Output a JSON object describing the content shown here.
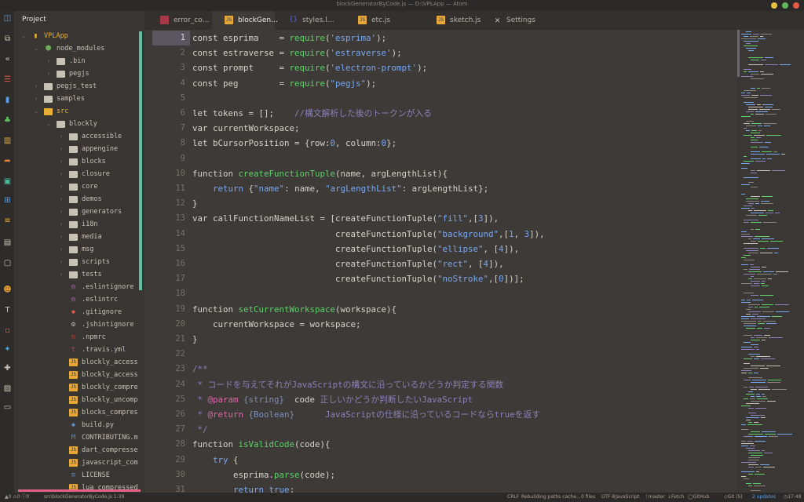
{
  "window": {
    "title": "blockGeneratorByCode.js — D:\\VPLApp — Atom"
  },
  "tree": {
    "header": "Project",
    "rows": [
      {
        "label": "VPLApp",
        "depth": 0,
        "arrow": "⌄",
        "icon": "repo-icon",
        "color": "#e8b030",
        "text_color": "#e8b030"
      },
      {
        "label": "node_modules",
        "depth": 1,
        "arrow": "⌄",
        "icon": "node-modules-icon",
        "color": "#6fae5a",
        "text_color": "#c8c1b6"
      },
      {
        "label": ".bin",
        "depth": 2,
        "arrow": "›",
        "icon": "folder-icon",
        "color": "#c8c1b6",
        "text_color": "#c8c1b6"
      },
      {
        "label": "pegjs",
        "depth": 2,
        "arrow": "›",
        "icon": "folder-icon",
        "color": "#c8c1b6",
        "text_color": "#c8c1b6"
      },
      {
        "label": "pegjs_test",
        "depth": 1,
        "arrow": "›",
        "icon": "folder-icon",
        "color": "#c8c1b6",
        "text_color": "#c8c1b6"
      },
      {
        "label": "samples",
        "depth": 1,
        "arrow": "›",
        "icon": "folder-icon",
        "color": "#c8c1b6",
        "text_color": "#c8c1b6"
      },
      {
        "label": "src",
        "depth": 1,
        "arrow": "⌄",
        "icon": "folder-open-icon",
        "color": "#e8b030",
        "text_color": "#e8b030"
      },
      {
        "label": "blockly",
        "depth": 2,
        "arrow": "⌄",
        "icon": "folder-open-icon",
        "color": "#c8c1b6",
        "text_color": "#c8c1b6"
      },
      {
        "label": "accessible",
        "depth": 3,
        "arrow": "›",
        "icon": "folder-icon",
        "color": "#c8c1b6",
        "text_color": "#c8c1b6"
      },
      {
        "label": "appengine",
        "depth": 3,
        "arrow": "›",
        "icon": "folder-icon",
        "color": "#c8c1b6",
        "text_color": "#c8c1b6"
      },
      {
        "label": "blocks",
        "depth": 3,
        "arrow": "›",
        "icon": "folder-icon",
        "color": "#c8c1b6",
        "text_color": "#c8c1b6"
      },
      {
        "label": "closure",
        "depth": 3,
        "arrow": "›",
        "icon": "folder-icon",
        "color": "#c8c1b6",
        "text_color": "#c8c1b6"
      },
      {
        "label": "core",
        "depth": 3,
        "arrow": "›",
        "icon": "folder-icon",
        "color": "#c8c1b6",
        "text_color": "#c8c1b6"
      },
      {
        "label": "demos",
        "depth": 3,
        "arrow": "›",
        "icon": "folder-icon",
        "color": "#c8c1b6",
        "text_color": "#c8c1b6"
      },
      {
        "label": "generators",
        "depth": 3,
        "arrow": "›",
        "icon": "folder-icon",
        "color": "#c8c1b6",
        "text_color": "#c8c1b6"
      },
      {
        "label": "i18n",
        "depth": 3,
        "arrow": "›",
        "icon": "folder-icon",
        "color": "#c8c1b6",
        "text_color": "#c8c1b6"
      },
      {
        "label": "media",
        "depth": 3,
        "arrow": "›",
        "icon": "folder-icon",
        "color": "#c8c1b6",
        "text_color": "#c8c1b6"
      },
      {
        "label": "msg",
        "depth": 3,
        "arrow": "›",
        "icon": "folder-icon",
        "color": "#c8c1b6",
        "text_color": "#c8c1b6"
      },
      {
        "label": "scripts",
        "depth": 3,
        "arrow": "›",
        "icon": "folder-icon",
        "color": "#c8c1b6",
        "text_color": "#c8c1b6"
      },
      {
        "label": "tests",
        "depth": 3,
        "arrow": "›",
        "icon": "folder-icon",
        "color": "#c8c1b6",
        "text_color": "#c8c1b6"
      },
      {
        "label": ".eslintignore",
        "depth": 3,
        "arrow": "",
        "icon": "eslint-icon",
        "color": "#c868c8",
        "text_color": "#c8c1b6"
      },
      {
        "label": ".eslintrc",
        "depth": 3,
        "arrow": "",
        "icon": "eslint-icon",
        "color": "#c868c8",
        "text_color": "#c8c1b6"
      },
      {
        "label": ".gitignore",
        "depth": 3,
        "arrow": "",
        "icon": "git-icon",
        "color": "#e05848",
        "text_color": "#c8c1b6"
      },
      {
        "label": ".jshintignore",
        "depth": 3,
        "arrow": "",
        "icon": "gear-icon",
        "color": "#c8c1b6",
        "text_color": "#c8c1b6"
      },
      {
        "label": ".npmrc",
        "depth": 3,
        "arrow": "",
        "icon": "npm-icon",
        "color": "#c83838",
        "text_color": "#c8c1b6"
      },
      {
        "label": ".travis.yml",
        "depth": 3,
        "arrow": "",
        "icon": "travis-icon",
        "color": "#b04858",
        "text_color": "#c8c1b6"
      },
      {
        "label": "blockly_access",
        "depth": 3,
        "arrow": "",
        "icon": "js-file-icon",
        "color": "#e8a838",
        "text_color": "#c8c1b6"
      },
      {
        "label": "blockly_access",
        "depth": 3,
        "arrow": "",
        "icon": "js-file-icon",
        "color": "#e8a838",
        "text_color": "#c8c1b6"
      },
      {
        "label": "blockly_compre",
        "depth": 3,
        "arrow": "",
        "icon": "js-file-icon",
        "color": "#e8a838",
        "text_color": "#c8c1b6"
      },
      {
        "label": "blockly_uncomp",
        "depth": 3,
        "arrow": "",
        "icon": "js-file-icon",
        "color": "#e8a838",
        "text_color": "#c8c1b6"
      },
      {
        "label": "blocks_compres",
        "depth": 3,
        "arrow": "",
        "icon": "js-file-icon",
        "color": "#e8a838",
        "text_color": "#c8c1b6"
      },
      {
        "label": "build.py",
        "depth": 3,
        "arrow": "",
        "icon": "python-icon",
        "color": "#5a8ac8",
        "text_color": "#c8c1b6"
      },
      {
        "label": "CONTRIBUTING.m",
        "depth": 3,
        "arrow": "",
        "icon": "markdown-icon",
        "color": "#5a8ac8",
        "text_color": "#c8c1b6"
      },
      {
        "label": "dart_compresse",
        "depth": 3,
        "arrow": "",
        "icon": "js-file-icon",
        "color": "#e8a838",
        "text_color": "#c8c1b6"
      },
      {
        "label": "javascript_com",
        "depth": 3,
        "arrow": "",
        "icon": "js-file-icon",
        "color": "#e8a838",
        "text_color": "#c8c1b6"
      },
      {
        "label": "LICENSE",
        "depth": 3,
        "arrow": "",
        "icon": "license-icon",
        "color": "#5a8ac8",
        "text_color": "#c8c1b6"
      },
      {
        "label": "lua_compressed",
        "depth": 3,
        "arrow": "",
        "icon": "js-file-icon",
        "color": "#e8a838",
        "text_color": "#c8c1b6"
      }
    ]
  },
  "tabs": [
    {
      "label": "error_co…",
      "icon": "js-file-icon",
      "icon_text": "",
      "color": "#a83848",
      "active": false
    },
    {
      "label": "blockGen…",
      "icon": "js-file-icon",
      "icon_text": "JS",
      "color": "#e8a838",
      "active": true
    },
    {
      "label": "styles.l…",
      "icon": "less-file-icon",
      "icon_text": "{}",
      "color": "#5a6ac8",
      "active": false
    },
    {
      "label": "etc.js",
      "icon": "js-file-icon",
      "icon_text": "JS",
      "color": "#e8a838",
      "active": false
    },
    {
      "label": "sketch.js",
      "icon": "js-file-icon",
      "icon_text": "JS",
      "color": "#e8a838",
      "active": false
    },
    {
      "label": "Settings",
      "icon": "settings-icon",
      "icon_text": "✕",
      "color": "#c8c1b6",
      "active": false
    }
  ],
  "editor": {
    "current_line": 1,
    "lines": [
      [
        [
          "k",
          "const esprima    = "
        ],
        [
          "fn",
          "require"
        ],
        [
          "k",
          "("
        ],
        [
          "st",
          "'esprima'"
        ],
        [
          "k",
          ");"
        ]
      ],
      [
        [
          "k",
          "const estraverse = "
        ],
        [
          "fn",
          "require"
        ],
        [
          "k",
          "("
        ],
        [
          "st",
          "'estraverse'"
        ],
        [
          "k",
          ");"
        ]
      ],
      [
        [
          "k",
          "const prompt     = "
        ],
        [
          "fn",
          "require"
        ],
        [
          "k",
          "("
        ],
        [
          "st",
          "'electron-prompt'"
        ],
        [
          "k",
          ");"
        ]
      ],
      [
        [
          "k",
          "const peg        = "
        ],
        [
          "fn",
          "require"
        ],
        [
          "k",
          "("
        ],
        [
          "st",
          "\"pegjs\""
        ],
        [
          "k",
          ");"
        ]
      ],
      [],
      [
        [
          "k",
          "let tokens = [];    "
        ],
        [
          "cm",
          "//構文解析した後のトークンが入る"
        ]
      ],
      [
        [
          "k",
          "var currentWorkspace;"
        ]
      ],
      [
        [
          "k",
          "let bCursorPosition = {row:"
        ],
        [
          "nm",
          "0"
        ],
        [
          "k",
          ", column:"
        ],
        [
          "nm",
          "0"
        ],
        [
          "k",
          "};"
        ]
      ],
      [],
      [
        [
          "k",
          "function "
        ],
        [
          "fn",
          "createFunctionTuple"
        ],
        [
          "k",
          "(name, argLengthList){"
        ]
      ],
      [
        [
          "k",
          "    "
        ],
        [
          "ret",
          "return"
        ],
        [
          "k",
          " {"
        ],
        [
          "st",
          "\"name\""
        ],
        [
          "k",
          ": name, "
        ],
        [
          "st",
          "\"argLengthList\""
        ],
        [
          "k",
          ": argLengthList};"
        ]
      ],
      [
        [
          "k",
          "}"
        ]
      ],
      [
        [
          "k",
          "var callFunctionNameList = [createFunctionTuple("
        ],
        [
          "st",
          "\"fill\""
        ],
        [
          "k",
          ",["
        ],
        [
          "nm",
          "3"
        ],
        [
          "k",
          "]),"
        ]
      ],
      [
        [
          "k",
          "                            createFunctionTuple("
        ],
        [
          "st",
          "\"background\""
        ],
        [
          "k",
          ",["
        ],
        [
          "nm",
          "1"
        ],
        [
          "k",
          ", "
        ],
        [
          "nm",
          "3"
        ],
        [
          "k",
          "]),"
        ]
      ],
      [
        [
          "k",
          "                            createFunctionTuple("
        ],
        [
          "st",
          "\"ellipse\""
        ],
        [
          "k",
          ", ["
        ],
        [
          "nm",
          "4"
        ],
        [
          "k",
          "]),"
        ]
      ],
      [
        [
          "k",
          "                            createFunctionTuple("
        ],
        [
          "st",
          "\"rect\""
        ],
        [
          "k",
          ", ["
        ],
        [
          "nm",
          "4"
        ],
        [
          "k",
          "]),"
        ]
      ],
      [
        [
          "k",
          "                            createFunctionTuple("
        ],
        [
          "st",
          "\"noStroke\""
        ],
        [
          "k",
          ",["
        ],
        [
          "nm",
          "0"
        ],
        [
          "k",
          "])];"
        ]
      ],
      [],
      [
        [
          "k",
          "function "
        ],
        [
          "fn",
          "setCurrentWorkspace"
        ],
        [
          "k",
          "(workspace){"
        ]
      ],
      [
        [
          "k",
          "    currentWorkspace = workspace;"
        ]
      ],
      [
        [
          "k",
          "}"
        ]
      ],
      [],
      [
        [
          "cm",
          "/**"
        ]
      ],
      [
        [
          "cm",
          " * コードを与えてそれがJavaScriptの構文に沿っているかどうか判定する関数"
        ]
      ],
      [
        [
          "cm",
          " * "
        ],
        [
          "cm-tag",
          "@param"
        ],
        [
          "cm-type",
          " {string}"
        ],
        [
          "k",
          "  code "
        ],
        [
          "cm",
          "正しいかどうか判断したいJavaScript"
        ]
      ],
      [
        [
          "cm",
          " * "
        ],
        [
          "cm-tag",
          "@return"
        ],
        [
          "cm-type",
          " {Boolean}"
        ],
        [
          "cm",
          "      JavaScriptの仕様に沿っているコードならtrueを返す"
        ]
      ],
      [
        [
          "cm",
          " */"
        ]
      ],
      [
        [
          "k",
          "function "
        ],
        [
          "fn",
          "isValidCode"
        ],
        [
          "k",
          "(code){"
        ]
      ],
      [
        [
          "k",
          "    "
        ],
        [
          "ret",
          "try"
        ],
        [
          "k",
          " {"
        ]
      ],
      [
        [
          "k",
          "        esprima."
        ],
        [
          "fn",
          "parse"
        ],
        [
          "k",
          "(code);"
        ]
      ],
      [
        [
          "k",
          "        "
        ],
        [
          "ret",
          "return"
        ],
        [
          "k",
          " "
        ],
        [
          "nm",
          "true"
        ],
        [
          "k",
          ";"
        ]
      ]
    ]
  },
  "statusbar": {
    "left": [
      "▲0  ⚠0  ⓘ0",
      "src\\blockGeneratorByCode.js  1:39"
    ],
    "right": [
      "CRLF",
      "Rebuilding paths cache...",
      "0 files",
      "UTF-8",
      "JavaScript",
      "ᚴmaster",
      "⇣Fetch",
      "◯GitHub",
      "◇Git (5)",
      "2 updates",
      "◷17:48"
    ]
  },
  "colors": {
    "accent": "#5fbf9f",
    "selection_bar": "#e06088",
    "close_red": "#e65a4a",
    "min_yellow": "#e8c040",
    "max_green": "#60b858"
  },
  "activity_icons": [
    {
      "name": "tree-view-icon",
      "glyph": "◫",
      "color": "#5a9be0"
    },
    {
      "name": "copy-icon",
      "glyph": "⧉",
      "color": "#c8c1b6"
    },
    {
      "name": "back-icon",
      "glyph": "«",
      "color": "#c8c1b6"
    },
    {
      "name": "list-icon",
      "glyph": "☰",
      "color": "#e05848"
    },
    {
      "name": "bookmark-icon",
      "glyph": "▮",
      "color": "#5a9be0"
    },
    {
      "name": "tree-icon",
      "glyph": "♣",
      "color": "#60c060"
    },
    {
      "name": "map-icon",
      "glyph": "▥",
      "color": "#e8b030"
    },
    {
      "name": "share-icon",
      "glyph": "➦",
      "color": "#e8803a"
    },
    {
      "name": "package-icon",
      "glyph": "▣",
      "color": "#40c0a0"
    },
    {
      "name": "sitemap-icon",
      "glyph": "⊞",
      "color": "#5a9be0"
    },
    {
      "name": "menu-icon",
      "glyph": "≡",
      "color": "#e8b030"
    },
    {
      "name": "chat-icon",
      "glyph": "▤",
      "color": "#c8c1b6"
    },
    {
      "name": "window-icon",
      "glyph": "▢",
      "color": "#c8c1b6"
    },
    {
      "name": "octocat-icon",
      "glyph": "☻",
      "color": "#e8a030"
    },
    {
      "name": "text-icon",
      "glyph": "T",
      "color": "#c8c1b6"
    },
    {
      "name": "square-icon",
      "glyph": "▫",
      "color": "#e05848"
    },
    {
      "name": "twitter-icon",
      "glyph": "✦",
      "color": "#40a8e0"
    },
    {
      "name": "puzzle-icon",
      "glyph": "✚",
      "color": "#c8c1b6"
    },
    {
      "name": "image-icon",
      "glyph": "▨",
      "color": "#c8c1b6"
    },
    {
      "name": "terminal-icon",
      "glyph": "▭",
      "color": "#c8c1b6"
    }
  ]
}
